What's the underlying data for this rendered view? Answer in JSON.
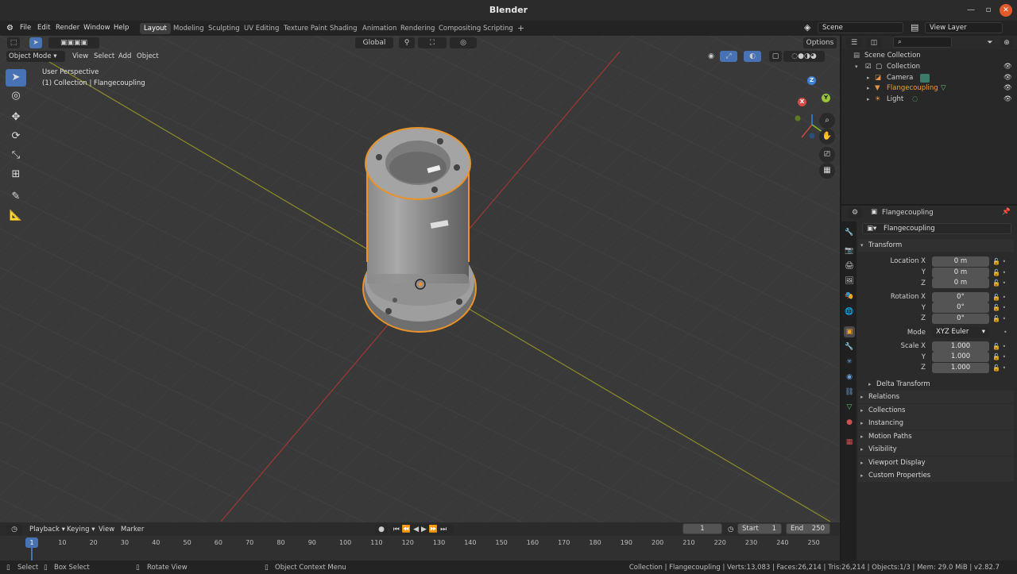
{
  "window": {
    "title": "Blender"
  },
  "menu": [
    "File",
    "Edit",
    "Render",
    "Window",
    "Help"
  ],
  "workspaces": [
    "Layout",
    "Modeling",
    "Sculpting",
    "UV Editing",
    "Texture Paint",
    "Shading",
    "Animation",
    "Rendering",
    "Compositing",
    "Scripting"
  ],
  "active_workspace": "Layout",
  "scene": {
    "name": "Scene",
    "view_layer": "View Layer"
  },
  "viewport": {
    "mode": "Object Mode",
    "menus": [
      "View",
      "Select",
      "Add",
      "Object"
    ],
    "transform_orientation": "Global",
    "options_label": "Options",
    "overlay_text": {
      "perspective": "User Perspective",
      "collection": "(1) Collection | Flangecoupling"
    },
    "gizmo_axes": {
      "x": "X",
      "y": "Y",
      "z": "Z"
    }
  },
  "outliner": {
    "root": "Scene Collection",
    "collection": "Collection",
    "items": [
      {
        "name": "Camera",
        "selected": false
      },
      {
        "name": "Flangecoupling",
        "selected": true
      },
      {
        "name": "Light",
        "selected": false
      }
    ]
  },
  "properties": {
    "object_name": "Flangecoupling",
    "datablock": "Flangecoupling",
    "transform_title": "Transform",
    "location": {
      "label_x": "Location X",
      "x": "0 m",
      "y": "0 m",
      "z": "0 m"
    },
    "rotation": {
      "label_x": "Rotation X",
      "x": "0°",
      "y": "0°",
      "z": "0°"
    },
    "mode_label": "Mode",
    "mode": "XYZ Euler",
    "scale": {
      "label_x": "Scale X",
      "x": "1.000",
      "y": "1.000",
      "z": "1.000"
    },
    "axis_labels": {
      "y": "Y",
      "z": "Z"
    },
    "delta": "Delta Transform",
    "sections": [
      "Relations",
      "Collections",
      "Instancing",
      "Motion Paths",
      "Visibility",
      "Viewport Display",
      "Custom Properties"
    ]
  },
  "timeline": {
    "menus": [
      "Playback",
      "Keying",
      "View",
      "Marker"
    ],
    "current_frame": "1",
    "start_label": "Start",
    "start": "1",
    "end_label": "End",
    "end": "250",
    "ticks": [
      "10",
      "20",
      "30",
      "40",
      "50",
      "60",
      "70",
      "80",
      "90",
      "100",
      "110",
      "120",
      "130",
      "140",
      "150",
      "160",
      "170",
      "180",
      "190",
      "200",
      "210",
      "220",
      "230",
      "240",
      "250"
    ],
    "playhead": "1"
  },
  "status": {
    "select": "Select",
    "box_select": "Box Select",
    "rotate_view": "Rotate View",
    "context_menu": "Object Context Menu",
    "info": "Collection | Flangecoupling | Verts:13,083 | Faces:26,214 | Tris:26,214 | Objects:1/3 | Mem: 29.0 MiB | v2.82.7"
  }
}
